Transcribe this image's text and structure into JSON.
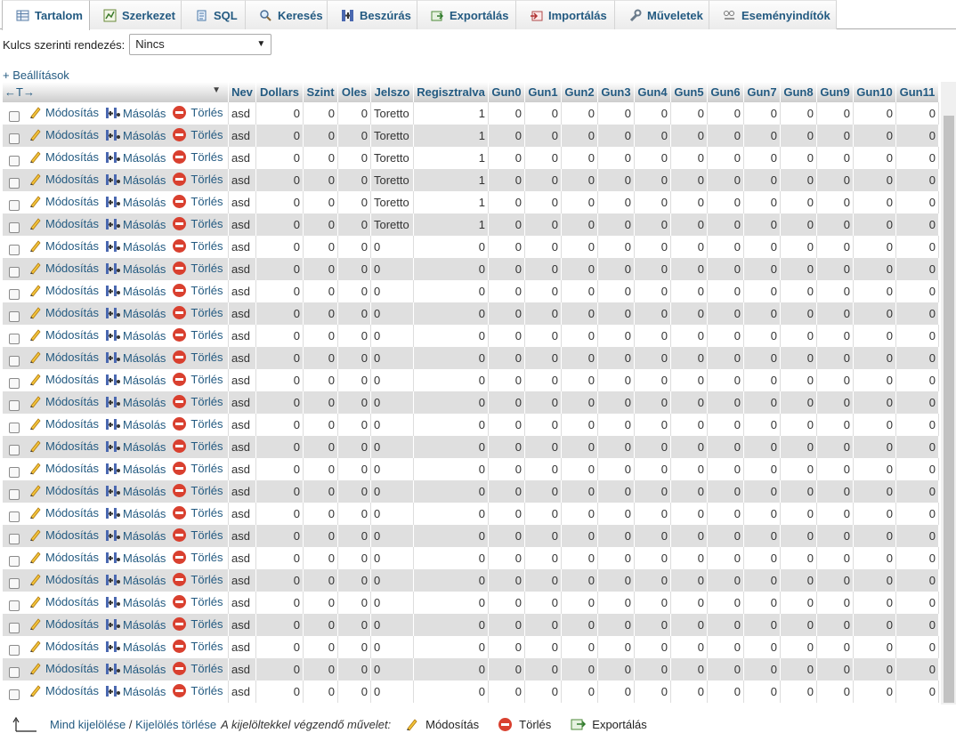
{
  "tabs": [
    {
      "label": "Tartalom",
      "icon": "table-icon",
      "active": true
    },
    {
      "label": "Szerkezet",
      "icon": "structure-icon",
      "active": false
    },
    {
      "label": "SQL",
      "icon": "sql-icon",
      "active": false
    },
    {
      "label": "Keresés",
      "icon": "search-icon",
      "active": false
    },
    {
      "label": "Beszúrás",
      "icon": "insert-icon",
      "active": false
    },
    {
      "label": "Exportálás",
      "icon": "export-icon",
      "active": false
    },
    {
      "label": "Importálás",
      "icon": "import-icon",
      "active": false
    },
    {
      "label": "Műveletek",
      "icon": "wrench-icon",
      "active": false
    },
    {
      "label": "Eseményindítók",
      "icon": "trigger-icon",
      "active": false
    }
  ],
  "sort": {
    "label": "Kulcs szerinti rendezés:",
    "value": "Nincs"
  },
  "settings_link": "+ Beállítások",
  "table": {
    "nav_arrows": "←T→",
    "columns": [
      "Nev",
      "Dollars",
      "Szint",
      "Oles",
      "Jelszo",
      "Regisztralva",
      "Gun0",
      "Gun1",
      "Gun2",
      "Gun3",
      "Gun4",
      "Gun5",
      "Gun6",
      "Gun7",
      "Gun8",
      "Gun9",
      "Gun10",
      "Gun11"
    ],
    "actions": {
      "edit": "Módosítás",
      "copy": "Másolás",
      "delete": "Törlés"
    },
    "rows": [
      [
        "asd",
        "0",
        "0",
        "0",
        "Toretto",
        "1",
        "0",
        "0",
        "0",
        "0",
        "0",
        "0",
        "0",
        "0",
        "0",
        "0",
        "0",
        "0"
      ],
      [
        "asd",
        "0",
        "0",
        "0",
        "Toretto",
        "1",
        "0",
        "0",
        "0",
        "0",
        "0",
        "0",
        "0",
        "0",
        "0",
        "0",
        "0",
        "0"
      ],
      [
        "asd",
        "0",
        "0",
        "0",
        "Toretto",
        "1",
        "0",
        "0",
        "0",
        "0",
        "0",
        "0",
        "0",
        "0",
        "0",
        "0",
        "0",
        "0"
      ],
      [
        "asd",
        "0",
        "0",
        "0",
        "Toretto",
        "1",
        "0",
        "0",
        "0",
        "0",
        "0",
        "0",
        "0",
        "0",
        "0",
        "0",
        "0",
        "0"
      ],
      [
        "asd",
        "0",
        "0",
        "0",
        "Toretto",
        "1",
        "0",
        "0",
        "0",
        "0",
        "0",
        "0",
        "0",
        "0",
        "0",
        "0",
        "0",
        "0"
      ],
      [
        "asd",
        "0",
        "0",
        "0",
        "Toretto",
        "1",
        "0",
        "0",
        "0",
        "0",
        "0",
        "0",
        "0",
        "0",
        "0",
        "0",
        "0",
        "0"
      ],
      [
        "asd",
        "0",
        "0",
        "0",
        "0",
        "0",
        "0",
        "0",
        "0",
        "0",
        "0",
        "0",
        "0",
        "0",
        "0",
        "0",
        "0",
        "0"
      ],
      [
        "asd",
        "0",
        "0",
        "0",
        "0",
        "0",
        "0",
        "0",
        "0",
        "0",
        "0",
        "0",
        "0",
        "0",
        "0",
        "0",
        "0",
        "0"
      ],
      [
        "asd",
        "0",
        "0",
        "0",
        "0",
        "0",
        "0",
        "0",
        "0",
        "0",
        "0",
        "0",
        "0",
        "0",
        "0",
        "0",
        "0",
        "0"
      ],
      [
        "asd",
        "0",
        "0",
        "0",
        "0",
        "0",
        "0",
        "0",
        "0",
        "0",
        "0",
        "0",
        "0",
        "0",
        "0",
        "0",
        "0",
        "0"
      ],
      [
        "asd",
        "0",
        "0",
        "0",
        "0",
        "0",
        "0",
        "0",
        "0",
        "0",
        "0",
        "0",
        "0",
        "0",
        "0",
        "0",
        "0",
        "0"
      ],
      [
        "asd",
        "0",
        "0",
        "0",
        "0",
        "0",
        "0",
        "0",
        "0",
        "0",
        "0",
        "0",
        "0",
        "0",
        "0",
        "0",
        "0",
        "0"
      ],
      [
        "asd",
        "0",
        "0",
        "0",
        "0",
        "0",
        "0",
        "0",
        "0",
        "0",
        "0",
        "0",
        "0",
        "0",
        "0",
        "0",
        "0",
        "0"
      ],
      [
        "asd",
        "0",
        "0",
        "0",
        "0",
        "0",
        "0",
        "0",
        "0",
        "0",
        "0",
        "0",
        "0",
        "0",
        "0",
        "0",
        "0",
        "0"
      ],
      [
        "asd",
        "0",
        "0",
        "0",
        "0",
        "0",
        "0",
        "0",
        "0",
        "0",
        "0",
        "0",
        "0",
        "0",
        "0",
        "0",
        "0",
        "0"
      ],
      [
        "asd",
        "0",
        "0",
        "0",
        "0",
        "0",
        "0",
        "0",
        "0",
        "0",
        "0",
        "0",
        "0",
        "0",
        "0",
        "0",
        "0",
        "0"
      ],
      [
        "asd",
        "0",
        "0",
        "0",
        "0",
        "0",
        "0",
        "0",
        "0",
        "0",
        "0",
        "0",
        "0",
        "0",
        "0",
        "0",
        "0",
        "0"
      ],
      [
        "asd",
        "0",
        "0",
        "0",
        "0",
        "0",
        "0",
        "0",
        "0",
        "0",
        "0",
        "0",
        "0",
        "0",
        "0",
        "0",
        "0",
        "0"
      ],
      [
        "asd",
        "0",
        "0",
        "0",
        "0",
        "0",
        "0",
        "0",
        "0",
        "0",
        "0",
        "0",
        "0",
        "0",
        "0",
        "0",
        "0",
        "0"
      ],
      [
        "asd",
        "0",
        "0",
        "0",
        "0",
        "0",
        "0",
        "0",
        "0",
        "0",
        "0",
        "0",
        "0",
        "0",
        "0",
        "0",
        "0",
        "0"
      ],
      [
        "asd",
        "0",
        "0",
        "0",
        "0",
        "0",
        "0",
        "0",
        "0",
        "0",
        "0",
        "0",
        "0",
        "0",
        "0",
        "0",
        "0",
        "0"
      ],
      [
        "asd",
        "0",
        "0",
        "0",
        "0",
        "0",
        "0",
        "0",
        "0",
        "0",
        "0",
        "0",
        "0",
        "0",
        "0",
        "0",
        "0",
        "0"
      ],
      [
        "asd",
        "0",
        "0",
        "0",
        "0",
        "0",
        "0",
        "0",
        "0",
        "0",
        "0",
        "0",
        "0",
        "0",
        "0",
        "0",
        "0",
        "0"
      ],
      [
        "asd",
        "0",
        "0",
        "0",
        "0",
        "0",
        "0",
        "0",
        "0",
        "0",
        "0",
        "0",
        "0",
        "0",
        "0",
        "0",
        "0",
        "0"
      ],
      [
        "asd",
        "0",
        "0",
        "0",
        "0",
        "0",
        "0",
        "0",
        "0",
        "0",
        "0",
        "0",
        "0",
        "0",
        "0",
        "0",
        "0",
        "0"
      ],
      [
        "asd",
        "0",
        "0",
        "0",
        "0",
        "0",
        "0",
        "0",
        "0",
        "0",
        "0",
        "0",
        "0",
        "0",
        "0",
        "0",
        "0",
        "0"
      ],
      [
        "asd",
        "0",
        "0",
        "0",
        "0",
        "0",
        "0",
        "0",
        "0",
        "0",
        "0",
        "0",
        "0",
        "0",
        "0",
        "0",
        "0",
        "0"
      ]
    ]
  },
  "footer": {
    "check_all": "Mind kijelölése",
    "separator": " / ",
    "uncheck_all": "Kijelölés törlése",
    "with_selected": "A kijelöltekkel végzendő művelet:",
    "edit": "Módosítás",
    "delete": "Törlés",
    "export": "Exportálás"
  },
  "colors": {
    "link": "#235a81",
    "row_alt": "#dfdfdf",
    "delete_icon": "#d9402f"
  }
}
